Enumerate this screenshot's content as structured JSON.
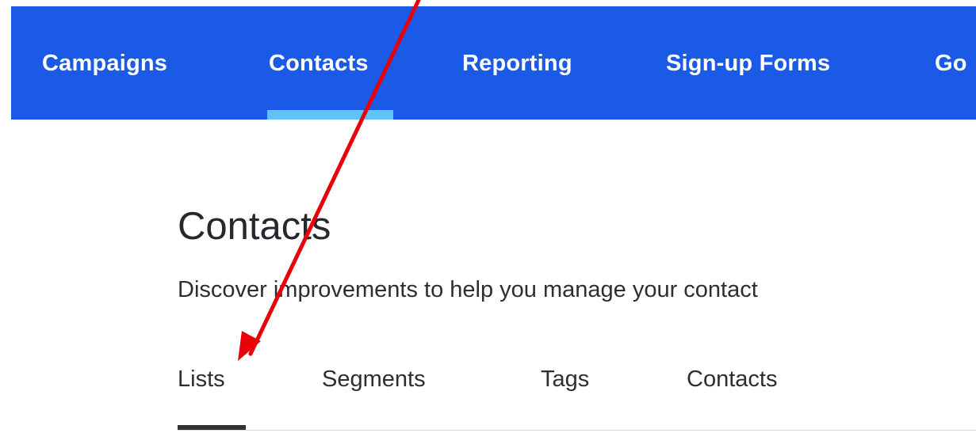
{
  "nav": {
    "items": [
      {
        "label": "Campaigns"
      },
      {
        "label": "Contacts",
        "active": true
      },
      {
        "label": "Reporting"
      },
      {
        "label": "Sign-up Forms"
      },
      {
        "label": "Go"
      }
    ],
    "background_color": "#1a5ae6",
    "active_indicator_color": "#5fc3f7"
  },
  "page": {
    "title": "Contacts",
    "subtitle": "Discover improvements to help you manage your contact"
  },
  "tabs": {
    "items": [
      {
        "label": "Lists",
        "active": true
      },
      {
        "label": "Segments"
      },
      {
        "label": "Tags"
      },
      {
        "label": "Contacts"
      }
    ]
  },
  "annotation": {
    "arrow_color": "#e8000b"
  }
}
